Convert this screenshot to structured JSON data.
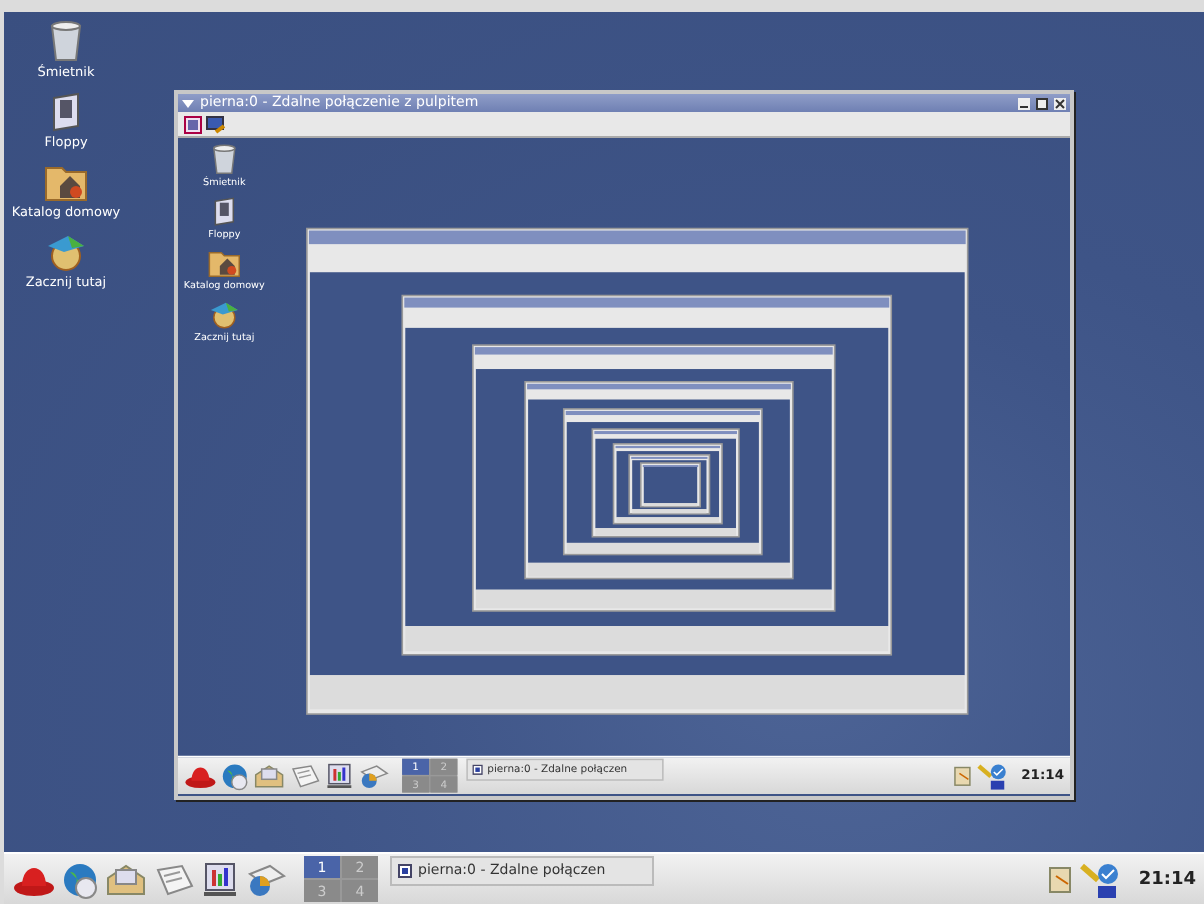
{
  "desktop": {
    "icons": [
      {
        "kind": "trash",
        "label": "Śmietnik"
      },
      {
        "kind": "floppy",
        "label": "Floppy"
      },
      {
        "kind": "home",
        "label": "Katalog domowy"
      },
      {
        "kind": "start",
        "label": "Zacznij tutaj"
      }
    ],
    "window": {
      "title": "pierna:0 - Zdalne połączenie z pulpitem",
      "remote_desktop": {
        "icons": [
          {
            "kind": "trash",
            "label": "Śmietnik"
          },
          {
            "kind": "floppy",
            "label": "Floppy"
          },
          {
            "kind": "home",
            "label": "Katalog domowy"
          },
          {
            "kind": "start",
            "label": "Zacznij tutaj"
          }
        ],
        "panel": {
          "workspaces": [
            {
              "label": "1",
              "selected": true
            },
            {
              "label": "2",
              "selected": false
            },
            {
              "label": "3",
              "selected": false
            },
            {
              "label": "4",
              "selected": false
            }
          ],
          "task": "pierna:0 - Zdalne połączen",
          "clock": "21:14"
        }
      }
    },
    "panel": {
      "workspaces": [
        {
          "label": "1",
          "selected": true
        },
        {
          "label": "2",
          "selected": false
        },
        {
          "label": "3",
          "selected": false
        },
        {
          "label": "4",
          "selected": false
        }
      ],
      "task": "pierna:0 - Zdalne połączen",
      "clock": "21:14"
    }
  }
}
